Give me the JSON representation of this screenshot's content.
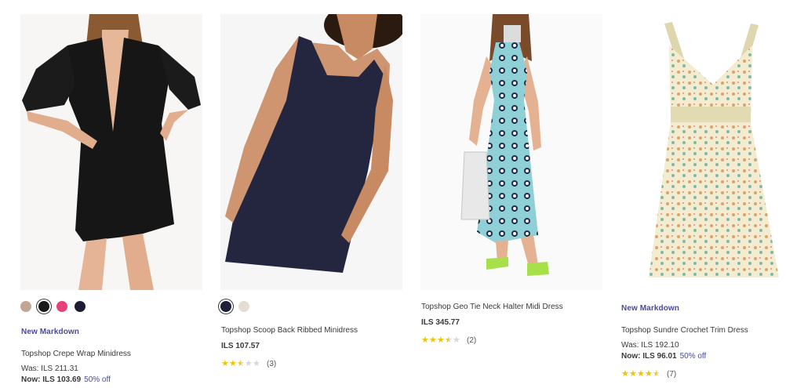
{
  "products": [
    {
      "name": "Topshop Crepe Wrap Minidress",
      "badge": "New Markdown",
      "was_label": "Was: ILS 211.31",
      "now_label": "Now: ILS 103.69",
      "off_label": "50% off",
      "swatches": [
        "#c3a594",
        "#1a1a1a",
        "#e8417a",
        "#1c1d33"
      ],
      "selected_swatch": 1
    },
    {
      "name": "Topshop Scoop Back Ribbed Minidress",
      "price": "ILS 107.57",
      "rating": 2.5,
      "review_count": "(3)",
      "swatches": [
        "#1e2238",
        "#e3ddd2"
      ],
      "selected_swatch": 0
    },
    {
      "name": "Topshop Geo Tie Neck Halter Midi Dress",
      "price": "ILS 345.77",
      "rating": 3.5,
      "review_count": "(2)"
    },
    {
      "name": "Topshop Sundre Crochet Trim Dress",
      "badge": "New Markdown",
      "was_label": "Was: ILS 192.10",
      "now_label": "Now: ILS 96.01",
      "off_label": "50% off",
      "rating": 4.5,
      "review_count": "(7)"
    }
  ],
  "colors": {
    "accent": "#4a4a9e",
    "star": "#f2c300",
    "star_empty": "#d8d8d8",
    "text": "#393939"
  }
}
